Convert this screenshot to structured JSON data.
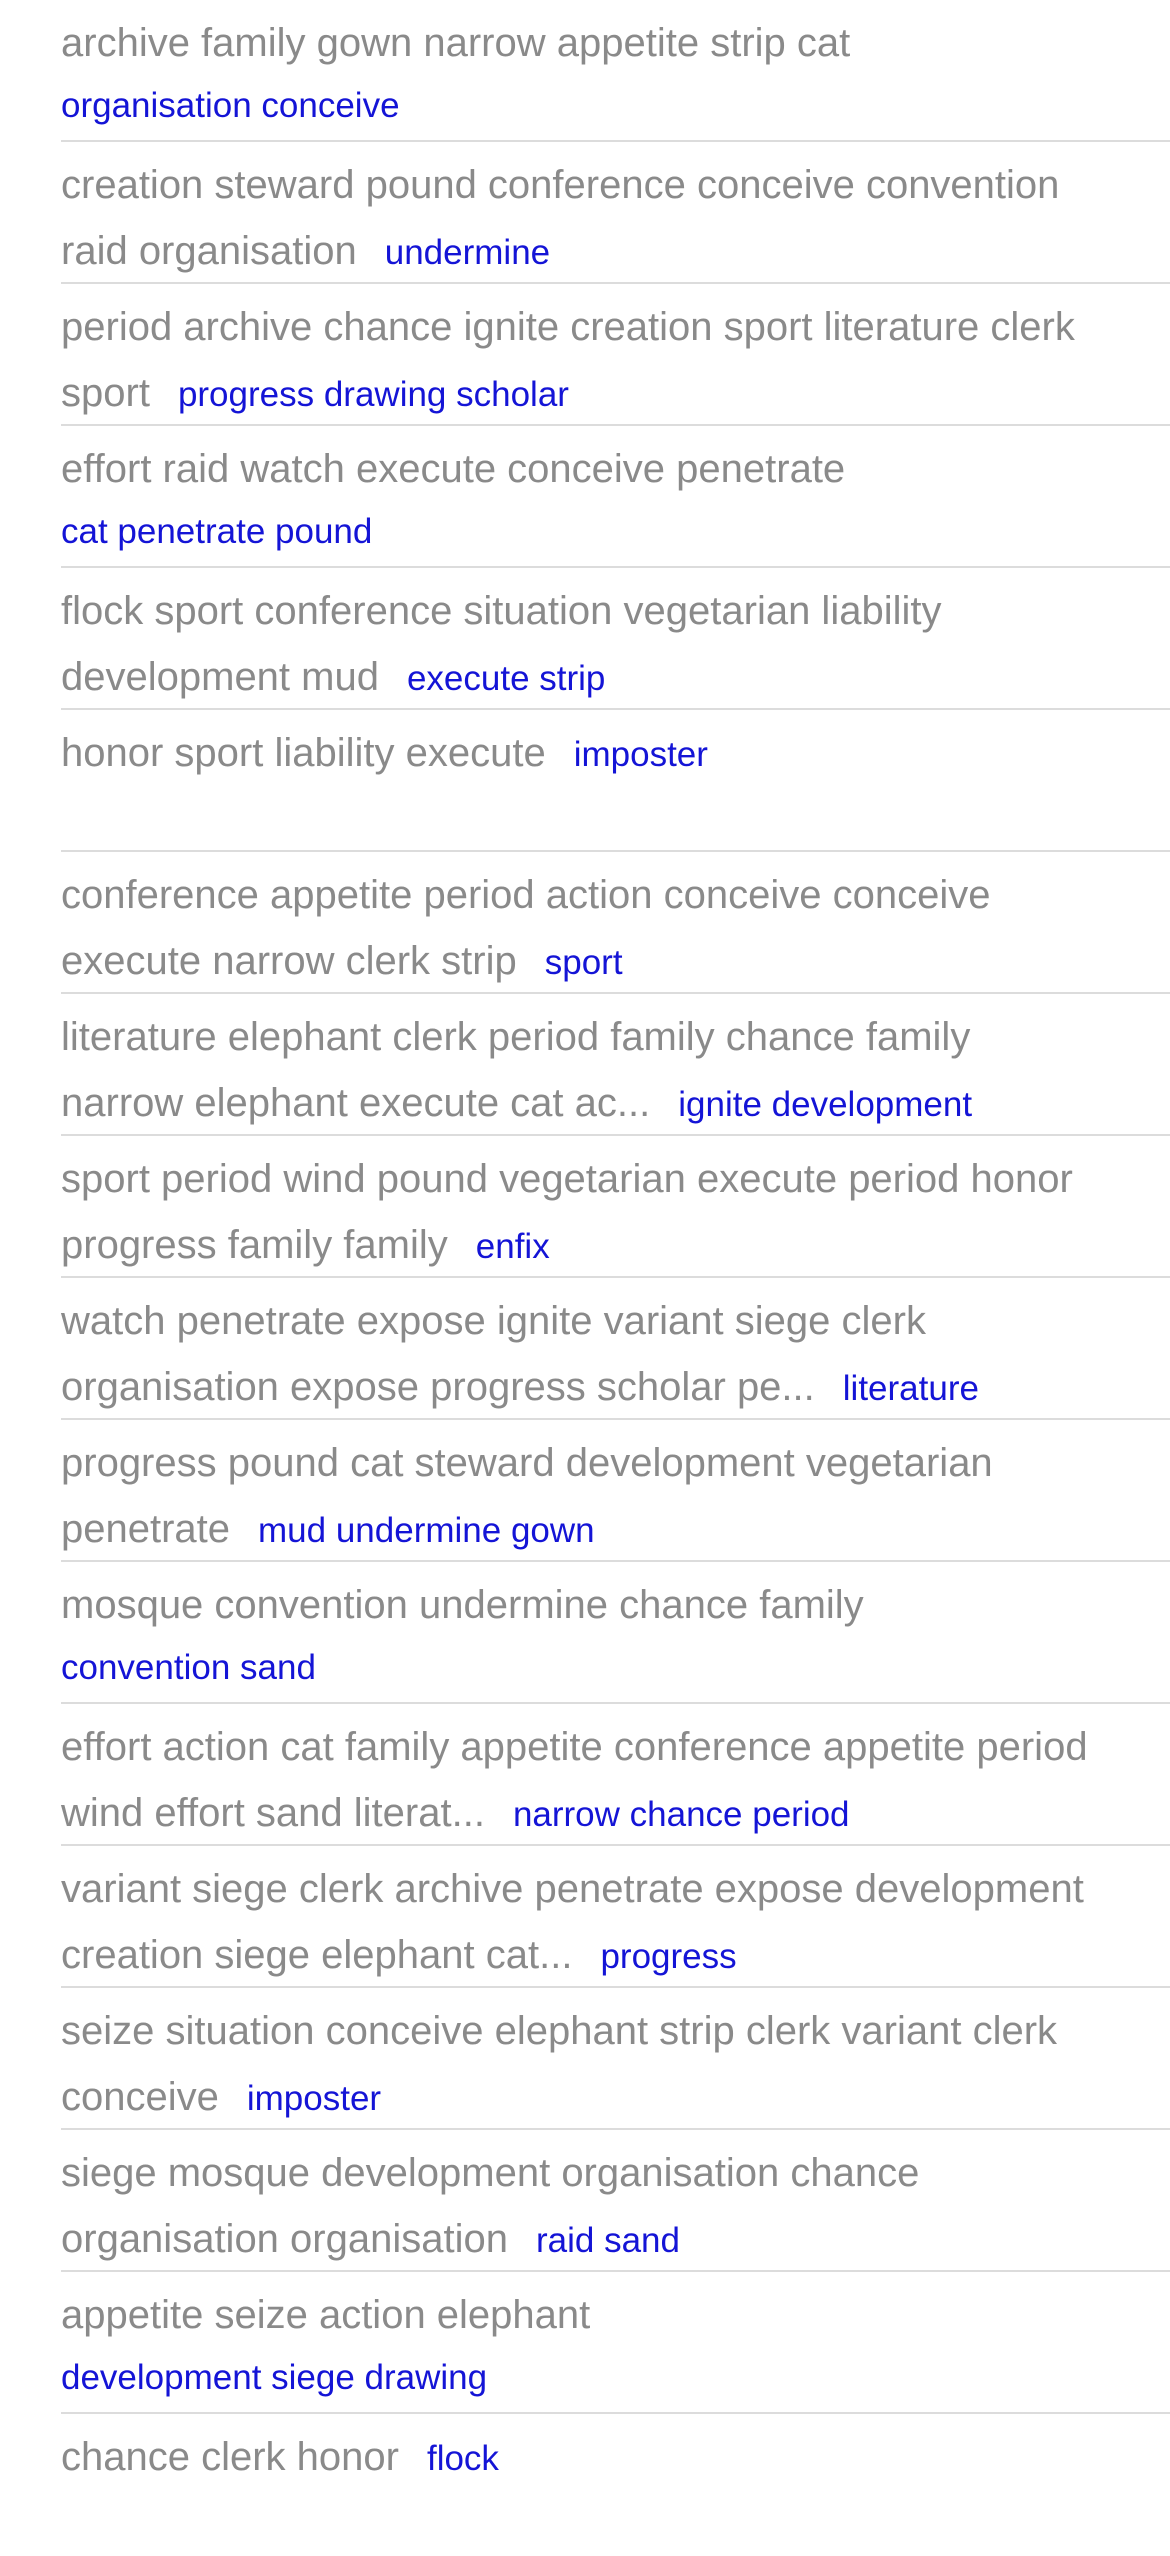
{
  "rows": [
    {
      "title": "archive family gown narrow appetite strip cat",
      "link": "organisation conceive",
      "link_newline": true
    },
    {
      "title": "creation steward pound conference conceive convention raid organisation",
      "link": "undermine",
      "link_newline": false
    },
    {
      "title": "period archive chance ignite creation sport literature clerk sport",
      "link": "progress drawing scholar",
      "link_newline": false
    },
    {
      "title": "effort raid watch execute conceive penetrate",
      "link": "cat penetrate pound",
      "link_newline": true
    },
    {
      "title": "flock sport conference situation vegetarian liability development mud",
      "link": "execute strip",
      "link_newline": false
    },
    {
      "title": "honor sport liability execute",
      "link": "imposter",
      "link_newline": false
    },
    {
      "title": "conference appetite period action conceive conceive execute narrow clerk strip",
      "link": "sport",
      "link_newline": false
    },
    {
      "title": "literature elephant clerk period family chance family narrow elephant execute cat ac...",
      "link": "ignite development",
      "link_newline": false
    },
    {
      "title": "sport period wind pound vegetarian execute period honor progress family family",
      "link": "enfix",
      "link_newline": false
    },
    {
      "title": "watch penetrate expose ignite variant siege clerk organisation expose progress scholar pe...",
      "link": "literature",
      "link_newline": false
    },
    {
      "title": "progress pound cat steward development vegetarian penetrate",
      "link": "mud undermine gown",
      "link_newline": false
    },
    {
      "title": "mosque convention undermine chance family",
      "link": "convention sand",
      "link_newline": true
    },
    {
      "title": "effort action cat family appetite conference appetite period wind effort sand literat...",
      "link": "narrow chance period",
      "link_newline": false
    },
    {
      "title": "variant siege clerk archive penetrate expose development creation siege elephant cat...",
      "link": "progress",
      "link_newline": false
    },
    {
      "title": "seize situation conceive elephant strip clerk variant clerk conceive",
      "link": "imposter",
      "link_newline": false
    },
    {
      "title": "siege mosque development organisation chance organisation organisation",
      "link": "raid sand",
      "link_newline": false
    },
    {
      "title": "appetite seize action elephant",
      "link": "development siege drawing",
      "link_newline": true
    },
    {
      "title": "chance clerk honor",
      "link": "flock",
      "link_newline": false
    }
  ],
  "colors": {
    "title_text": "#8a8a8a",
    "link_text": "#1414d6",
    "divider": "#dcdcdc",
    "background": "#ffffff"
  }
}
